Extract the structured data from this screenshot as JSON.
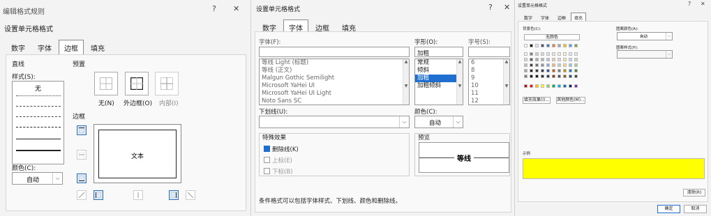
{
  "border_dialog": {
    "window_title": "编辑格式规则",
    "help": "?",
    "close": "✕",
    "subtitle": "设置单元格格式",
    "tabs": [
      "数字",
      "字体",
      "边框",
      "填充"
    ],
    "active_tab": 2,
    "line_section": "直线",
    "style_label": "样式(S):",
    "style_none": "无",
    "color_label": "颜色(C):",
    "color_value": "自动",
    "preset_label": "预置",
    "preset_none": "无(N)",
    "preset_outline": "外边框(O)",
    "preset_inside": "内部(I)",
    "border_label": "边框",
    "preview_text": "文本"
  },
  "font_dialog": {
    "title": "设置单元格格式",
    "help": "?",
    "close": "✕",
    "tabs": [
      "数字",
      "字体",
      "边框",
      "填充"
    ],
    "active_tab": 1,
    "font_label": "字体(F):",
    "font_list": [
      "等线 Light (标题)",
      "等线 (正文)",
      "Malgun Gothic Semilight",
      "Microsoft YaHei UI",
      "Microsoft YaHei UI Light",
      "Noto Sans SC"
    ],
    "style_label": "字形(O):",
    "style_value": "加粗",
    "style_list": [
      "常规",
      "倾斜",
      "加粗",
      "加粗倾斜"
    ],
    "style_selected": 2,
    "size_label": "字号(S):",
    "size_list": [
      "6",
      "8",
      "9",
      "10",
      "11",
      "12"
    ],
    "underline_label": "下划线(U):",
    "color_label": "颜色(C):",
    "color_value": "自动",
    "effects_label": "特殊效果",
    "strike_label": "删除线(K)",
    "super_label": "上标(E)",
    "sub_label": "下标(B)",
    "preview_label": "预览",
    "preview_text": "等线",
    "note": "条件格式可以包括字体样式、下划线、颜色和删除线。"
  },
  "fill_dialog": {
    "title": "设置单元格格式",
    "help": "?",
    "close": "✕",
    "tabs": [
      "数字",
      "字体",
      "边框",
      "填充"
    ],
    "active_tab": 3,
    "bg_label": "背景色(C):",
    "no_color": "无颜色",
    "pattern_color_label": "图案颜色(A):",
    "pattern_color_value": "自动",
    "pattern_style_label": "图案样式(P):",
    "fill_effects": "填充效果(I)...",
    "more_colors": "其他颜色(M)...",
    "sample_label": "示例",
    "sample_color": "#ffff00",
    "clear": "清除(R)",
    "ok": "确定",
    "cancel": "取消",
    "accent": "#1f6fd0"
  }
}
